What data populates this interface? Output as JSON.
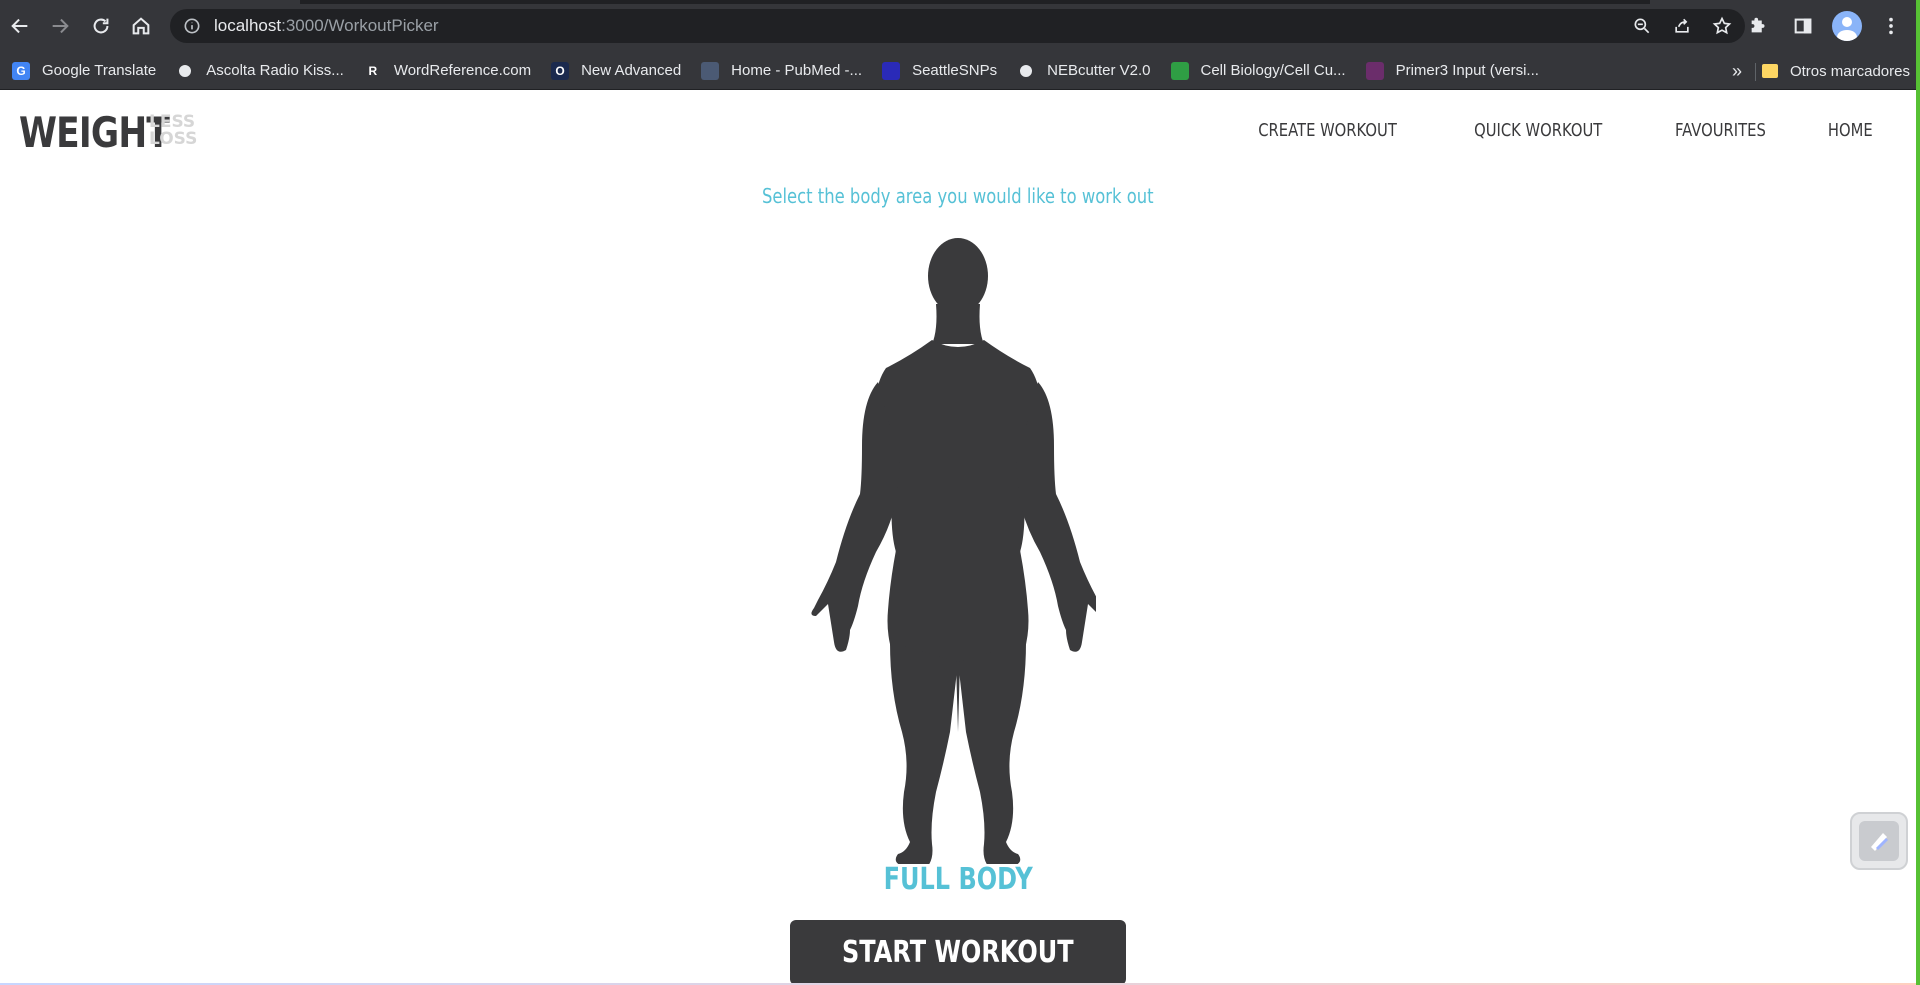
{
  "browser": {
    "url_host": "localhost",
    "url_path": ":3000/WorkoutPicker",
    "bookmarks": [
      {
        "label": "Google Translate",
        "icon": "google-translate-icon",
        "color": "#4285f4",
        "glyph": "G"
      },
      {
        "label": "Ascolta Radio Kiss...",
        "icon": "globe-icon",
        "color": "#5f6368",
        "glyph": ""
      },
      {
        "label": "WordReference.com",
        "icon": "wordreference-icon",
        "color": "#35363a",
        "glyph": "R"
      },
      {
        "label": "New Advanced",
        "icon": "new-advanced-icon",
        "color": "#1b2a4e",
        "glyph": "O"
      },
      {
        "label": "Home - PubMed -...",
        "icon": "pubmed-icon",
        "color": "#4b5a74",
        "glyph": ""
      },
      {
        "label": "SeattleSNPs",
        "icon": "seattlesnps-icon",
        "color": "#2a2ab8",
        "glyph": ""
      },
      {
        "label": "NEBcutter V2.0",
        "icon": "globe-icon",
        "color": "#5f6368",
        "glyph": ""
      },
      {
        "label": "Cell Biology/Cell Cu...",
        "icon": "cell-biology-icon",
        "color": "#2f9e44",
        "glyph": ""
      },
      {
        "label": "Primer3 Input (versi...",
        "icon": "primer3-icon",
        "color": "#6b2d6b",
        "glyph": ""
      }
    ],
    "more_label": "»",
    "other_bookmarks": "Otros marcadores"
  },
  "header": {
    "logo_main": "WEIGHT",
    "logo_sub_top": "LESS",
    "logo_sub_bottom": "LOSS",
    "nav": [
      "CREATE WORKOUT",
      "QUICK WORKOUT",
      "FAVOURITES",
      "HOME"
    ]
  },
  "main": {
    "prompt": "Select the body area you would like to work out",
    "selected_area": "FULL BODY",
    "start_button": "START WORKOUT"
  },
  "colors": {
    "accent": "#56c1d6",
    "dark": "#3a3a3c"
  }
}
